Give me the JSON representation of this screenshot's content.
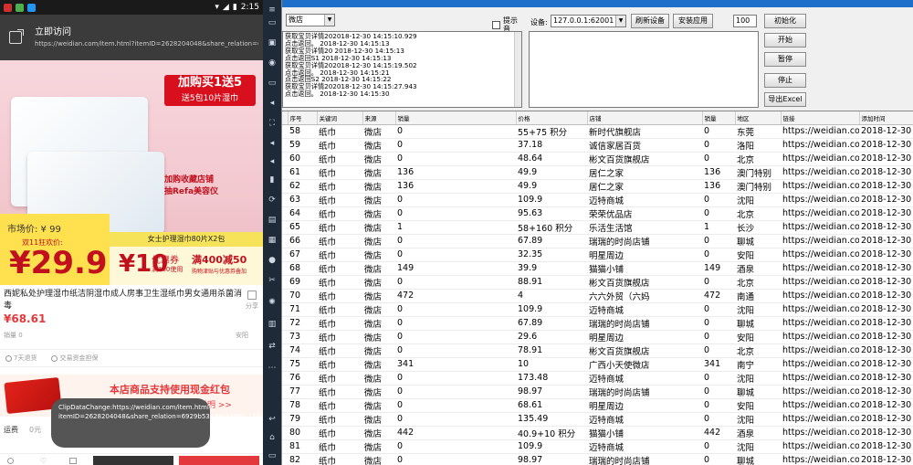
{
  "phone": {
    "status": {
      "time": "2:15"
    },
    "urlbar": {
      "title": "立即访问",
      "url": "https://weidian.com/item.html?itemID=2628204048&share_relation=69."
    },
    "promo": {
      "top_line1": "加购买1送5",
      "top_line2": "送5包10片湿巾",
      "mid_line1": "加购收藏店铺",
      "mid_line2": "抽Refa美容仪",
      "bar": "女士护理湿巾80片X2包",
      "market_price": "市场价: ¥ 99",
      "d11_label": "双11狂欢价:",
      "big_price": "¥29.9",
      "coupon_value": "¥10",
      "coupon_text": "优惠券",
      "coupon_sub": "满100使用",
      "discount": "满400减50",
      "discount_sub": "购物津贴与优惠券叠加"
    },
    "product": {
      "title": "西妮私处护理湿巾纸洁阴湿巾成人房事卫生湿纸巾男女通用杀菌消毒",
      "share_label": "分享",
      "price": "¥68.61",
      "sales": "销量 0",
      "region": "安阳",
      "guarantee_1": "7天退货",
      "guarantee_2": "交易资金担保"
    },
    "redpack": {
      "line1": "本店商品支持使用现金红包",
      "line2": "查看说明 >>"
    },
    "freight_label": "运费",
    "freight_value": "0元",
    "toast": "ClipDataChange:https://weidian.com/item.html?itemID=2628204048&share_relation=6929b53188c3386b__1&wfr=BuyercopyURL"
  },
  "app": {
    "source_combo": "微店",
    "checkbox_label": "提示音",
    "device_label": "设备:",
    "device_value": "127.0.0.1:62001",
    "refresh_button": "刷新设备",
    "install_button": "安装应用",
    "count_value": "100",
    "buttons": [
      "初始化",
      "开始",
      "暂停",
      "停止",
      "导出Excel"
    ],
    "log_lines": [
      "获取宝贝详情202018-12-30 14:15:10.929",
      "点击返回。 2018-12-30 14:15:13",
      "获取宝贝详情20 2018-12-30 14:15:13",
      "点击返回S1 2018-12-30 14:15:13",
      "获取宝贝详情202018-12-30 14:15:19.502",
      "点击返回。 2018-12-30 14:15:21",
      "点击返回S2 2018-12-30 14:15:22",
      "获取宝贝详情202018-12-30 14:15:27.943",
      "点击返回。 2018-12-30 14:15:30"
    ],
    "columns": [
      "序号",
      "关键词",
      "来源",
      "销量",
      "价格",
      "店铺",
      "销量",
      "地区",
      "链接",
      "添加时间"
    ],
    "rows": [
      [
        "58",
        "纸巾",
        "微店",
        "0",
        "55+75 积分",
        "新时代旗舰店",
        "0",
        "东莞",
        "https://weidian.co",
        "2018-12-30 14"
      ],
      [
        "59",
        "纸巾",
        "微店",
        "0",
        "37.18",
        "诚信家居百货",
        "0",
        "洛阳",
        "https://weidian.co",
        "2018-12-30 14"
      ],
      [
        "60",
        "纸巾",
        "微店",
        "0",
        "48.64",
        "彬文百货旗舰店",
        "0",
        "北京",
        "https://weidian.co",
        "2018-12-30 14"
      ],
      [
        "61",
        "纸巾",
        "微店",
        "136",
        "49.9",
        "居仁之家",
        "136",
        "澳门特别",
        "https://weidian.co",
        "2018-12-30 14"
      ],
      [
        "62",
        "纸巾",
        "微店",
        "136",
        "49.9",
        "居仁之家",
        "136",
        "澳门特别",
        "https://weidian.co",
        "2018-12-30 14"
      ],
      [
        "63",
        "纸巾",
        "微店",
        "0",
        "109.9",
        "迈特商城",
        "0",
        "沈阳",
        "https://weidian.co",
        "2018-12-30 14"
      ],
      [
        "64",
        "纸巾",
        "微店",
        "0",
        "95.63",
        "荣荣优品店",
        "0",
        "北京",
        "https://weidian.co",
        "2018-12-30 14"
      ],
      [
        "65",
        "纸巾",
        "微店",
        "1",
        "58+160 积分",
        "乐活生活馆",
        "1",
        "长沙",
        "https://weidian.co",
        "2018-12-30 14"
      ],
      [
        "66",
        "纸巾",
        "微店",
        "0",
        "67.89",
        "瑞瑞的时尚店铺",
        "0",
        "聊城",
        "https://weidian.co",
        "2018-12-30 14"
      ],
      [
        "67",
        "纸巾",
        "微店",
        "0",
        "32.35",
        "明星周边",
        "0",
        "安阳",
        "https://weidian.co",
        "2018-12-30 14"
      ],
      [
        "68",
        "纸巾",
        "微店",
        "149",
        "39.9",
        "猫猫小铺",
        "149",
        "酒泉",
        "https://weidian.co",
        "2018-12-30 14"
      ],
      [
        "69",
        "纸巾",
        "微店",
        "0",
        "88.91",
        "彬文百货旗舰店",
        "0",
        "北京",
        "https://weidian.co",
        "2018-12-30 14"
      ],
      [
        "70",
        "纸巾",
        "微店",
        "472",
        "4",
        "六六外贸（六妈",
        "472",
        "南通",
        "https://weidian.co",
        "2018-12-30 14"
      ],
      [
        "71",
        "纸巾",
        "微店",
        "0",
        "109.9",
        "迈特商城",
        "0",
        "沈阳",
        "https://weidian.co",
        "2018-12-30 14"
      ],
      [
        "72",
        "纸巾",
        "微店",
        "0",
        "67.89",
        "瑞瑞的时尚店铺",
        "0",
        "聊城",
        "https://weidian.co",
        "2018-12-30 14"
      ],
      [
        "73",
        "纸巾",
        "微店",
        "0",
        "29.6",
        "明星周边",
        "0",
        "安阳",
        "https://weidian.co",
        "2018-12-30 14"
      ],
      [
        "74",
        "纸巾",
        "微店",
        "0",
        "78.91",
        "彬文百货旗舰店",
        "0",
        "北京",
        "https://weidian.co",
        "2018-12-30 14"
      ],
      [
        "75",
        "纸巾",
        "微店",
        "341",
        "10",
        "广西小天使微店",
        "341",
        "南宁",
        "https://weidian.co",
        "2018-12-30 14"
      ],
      [
        "76",
        "纸巾",
        "微店",
        "0",
        "173.48",
        "迈特商城",
        "0",
        "沈阳",
        "https://weidian.co",
        "2018-12-30 14"
      ],
      [
        "77",
        "纸巾",
        "微店",
        "0",
        "98.97",
        "瑞瑞的时尚店铺",
        "0",
        "聊城",
        "https://weidian.co",
        "2018-12-30 14"
      ],
      [
        "78",
        "纸巾",
        "微店",
        "0",
        "68.61",
        "明星周边",
        "0",
        "安阳",
        "https://weidian.co",
        "2018-12-30 14"
      ],
      [
        "79",
        "纸巾",
        "微店",
        "0",
        "135.49",
        "迈特商城",
        "0",
        "沈阳",
        "https://weidian.co",
        "2018-12-30 14"
      ],
      [
        "80",
        "纸巾",
        "微店",
        "442",
        "40.9+10 积分",
        "猫猫小铺",
        "442",
        "酒泉",
        "https://weidian.co",
        "2018-12-30 14"
      ],
      [
        "81",
        "纸巾",
        "微店",
        "0",
        "109.9",
        "迈特商城",
        "0",
        "沈阳",
        "https://weidian.co",
        "2018-12-30 14"
      ],
      [
        "82",
        "纸巾",
        "微店",
        "0",
        "98.97",
        "瑞瑞的时尚店铺",
        "0",
        "聊城",
        "https://weidian.co",
        "2018-12-30 14"
      ]
    ]
  }
}
